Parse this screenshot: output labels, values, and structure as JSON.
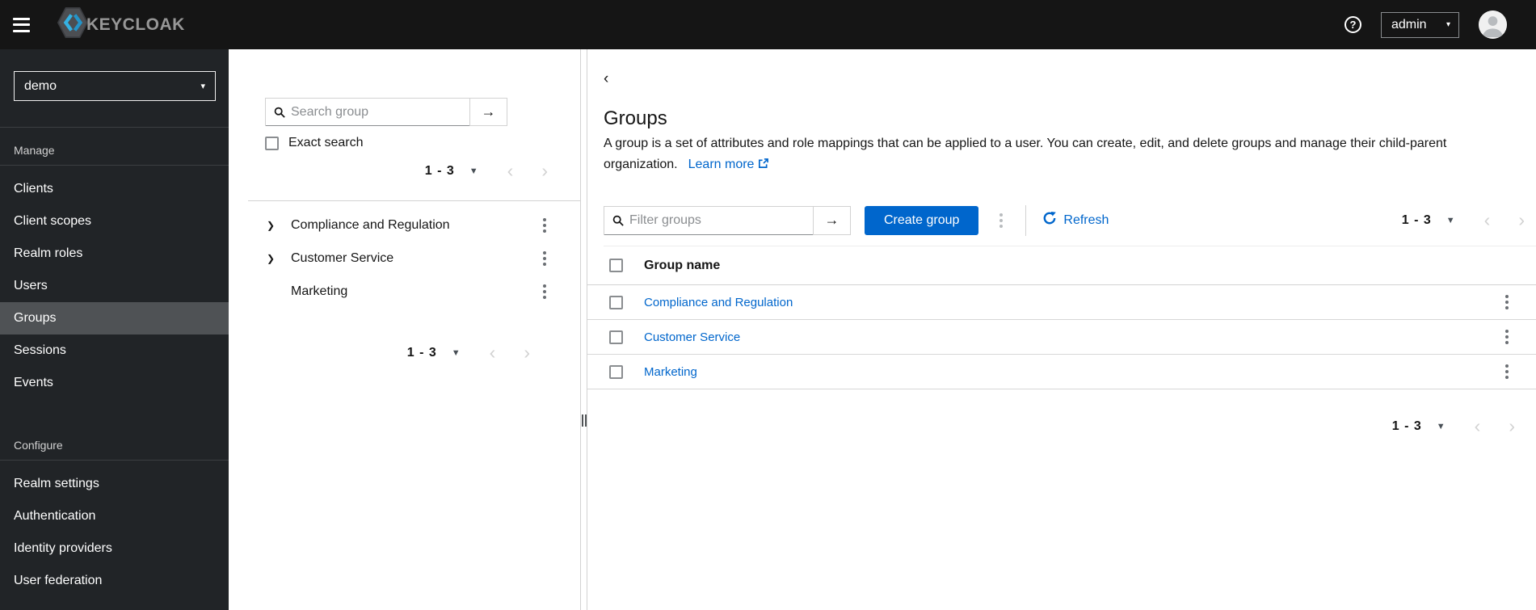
{
  "masthead": {
    "brand": "KEYCLOAK",
    "username": "admin"
  },
  "sidebar": {
    "realm_selector": {
      "value": "demo"
    },
    "sections": [
      {
        "title": "Manage",
        "items": [
          {
            "label": "Clients",
            "active": false
          },
          {
            "label": "Client scopes",
            "active": false
          },
          {
            "label": "Realm roles",
            "active": false
          },
          {
            "label": "Users",
            "active": false
          },
          {
            "label": "Groups",
            "active": true
          },
          {
            "label": "Sessions",
            "active": false
          },
          {
            "label": "Events",
            "active": false
          }
        ]
      },
      {
        "title": "Configure",
        "items": [
          {
            "label": "Realm settings",
            "active": false
          },
          {
            "label": "Authentication",
            "active": false
          },
          {
            "label": "Identity providers",
            "active": false
          },
          {
            "label": "User federation",
            "active": false
          }
        ]
      }
    ]
  },
  "tree_panel": {
    "search": {
      "placeholder": "Search group"
    },
    "exact_search_label": "Exact search",
    "pagination_top": {
      "range": "1 - 3"
    },
    "pagination_bottom": {
      "range": "1 - 3"
    },
    "items": [
      {
        "label": "Compliance and Regulation",
        "expandable": true
      },
      {
        "label": "Customer Service",
        "expandable": true
      },
      {
        "label": "Marketing",
        "expandable": false
      }
    ]
  },
  "main": {
    "title": "Groups",
    "description": "A group is a set of attributes and role mappings that can be applied to a user. You can create, edit, and delete groups and manage their child-parent organization.",
    "learn_more_label": "Learn more",
    "toolbar": {
      "filter_placeholder": "Filter groups",
      "create_button_label": "Create group",
      "refresh_label": "Refresh",
      "pagination": {
        "range": "1 - 3"
      }
    },
    "table": {
      "columns": [
        "Group name"
      ],
      "rows": [
        {
          "name": "Compliance and Regulation"
        },
        {
          "name": "Customer Service"
        },
        {
          "name": "Marketing"
        }
      ]
    },
    "pagination_bottom": {
      "range": "1 - 3"
    }
  },
  "colors": {
    "accent": "#0066cc",
    "masthead_bg": "#151515",
    "sidebar_bg": "#212427",
    "sidebar_active": "#4f5255"
  }
}
